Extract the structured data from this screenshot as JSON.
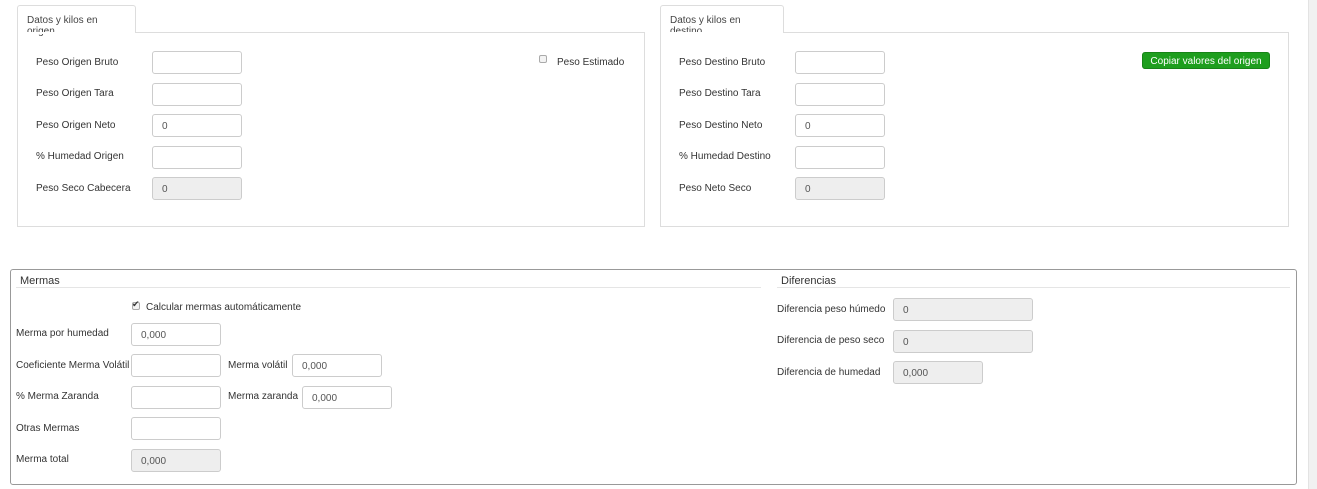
{
  "origen": {
    "tab": "Datos y kilos en origen",
    "bruto_label": "Peso Origen Bruto",
    "bruto_value": "",
    "tara_label": "Peso Origen Tara",
    "tara_value": "",
    "neto_label": "Peso Origen Neto",
    "neto_value": "0",
    "humedad_label": "% Humedad Origen",
    "humedad_value": "",
    "seco_label": "Peso Seco Cabecera",
    "seco_value": "0",
    "estimado_label": "Peso Estimado",
    "estimado_checked": false
  },
  "destino": {
    "tab": "Datos y kilos en destino",
    "bruto_label": "Peso Destino Bruto",
    "bruto_value": "",
    "tara_label": "Peso Destino Tara",
    "tara_value": "",
    "neto_label": "Peso Destino Neto",
    "neto_value": "0",
    "humedad_label": "% Humedad Destino",
    "humedad_value": "",
    "seco_label": "Peso Neto Seco",
    "seco_value": "0",
    "copy_button": "Copiar valores del origen"
  },
  "mermas": {
    "title": "Mermas",
    "auto_label": "Calcular mermas automáticamente",
    "auto_checked": true,
    "humedad_label": "Merma por humedad",
    "humedad_value": "0,000",
    "coef_label": "Coeficiente Merma Volátil",
    "coef_value": "",
    "volatil_label": "Merma volátil",
    "volatil_value": "0,000",
    "zaranda_pct_label": "% Merma Zaranda",
    "zaranda_pct_value": "",
    "zaranda_label": "Merma zaranda",
    "zaranda_value": "0,000",
    "otras_label": "Otras Mermas",
    "otras_value": "",
    "total_label": "Merma total",
    "total_value": "0,000"
  },
  "diferencias": {
    "title": "Diferencias",
    "humedo_label": "Diferencia peso húmedo",
    "humedo_value": "0",
    "seco_label": "Diferencia de peso seco",
    "seco_value": "0",
    "humedad_label": "Diferencia de humedad",
    "humedad_value": "0,000"
  },
  "colors": {
    "accent_green": "#1e9e1e",
    "readonly_bg": "#eeeeee",
    "border": "#dddddd"
  }
}
